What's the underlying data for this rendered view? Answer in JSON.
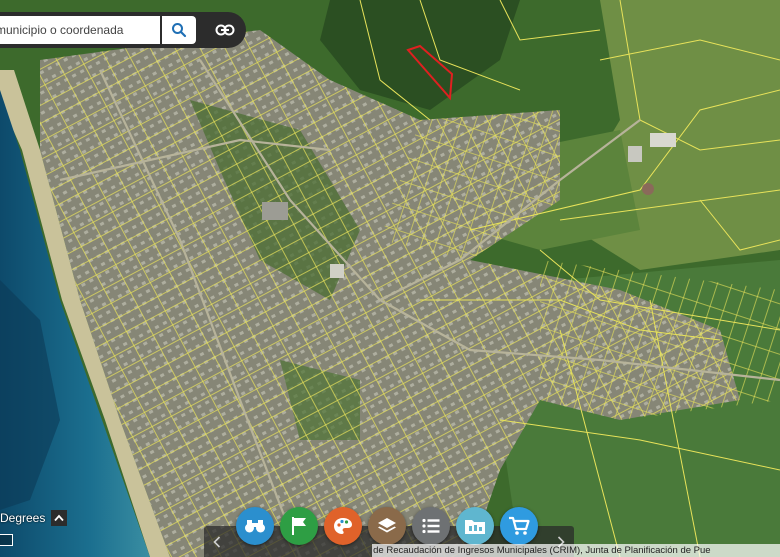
{
  "search": {
    "placeholder": "municipio o coordenada"
  },
  "icons": {
    "search": "search-icon",
    "link": "link-icon",
    "chevron_up": "chevron-up-icon",
    "prev": "chevron-left-icon",
    "next": "chevron-right-icon"
  },
  "coordinates": {
    "label": "Degrees"
  },
  "toolbar": {
    "buttons": [
      {
        "icon": "binoculars-icon",
        "color": "#2b8fce"
      },
      {
        "icon": "flag-icon",
        "color": "#2e9e44"
      },
      {
        "icon": "palette-icon",
        "color": "#e0622a"
      },
      {
        "icon": "layers-icon",
        "color": "#8a6a4a"
      },
      {
        "icon": "list-icon",
        "color": "#6e7173"
      },
      {
        "icon": "folder-icon",
        "color": "#5fb6cf"
      },
      {
        "icon": "cart-icon",
        "color": "#2f9be0"
      }
    ]
  },
  "attribution": {
    "text": "Centro de Recaudación de Ingresos Municipales (CRIM), Junta de Planificación de Pue"
  },
  "colors": {
    "parcel_lines": "#e8e35a",
    "highlight_parcel": "#e02020",
    "ocean": "#1d6f8e",
    "shore": "#c9c29a",
    "vegetation": "#3f6a2e",
    "urban": "#8d8d7a"
  }
}
